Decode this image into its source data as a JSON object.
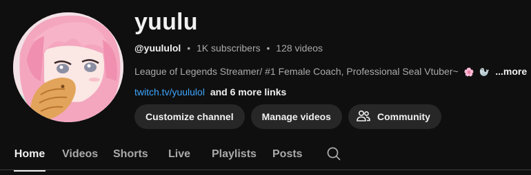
{
  "channel": {
    "name": "yuulu",
    "handle": "@yuululol",
    "subscribers": "1K subscribers",
    "videos": "128 videos",
    "separator": "•",
    "description": "League of Legends Streamer/ #1 Female Coach, Professional Seal Vtuber~",
    "description_emoji_1": "🌸",
    "description_emoji_2": "🦭",
    "more_label": "...more",
    "link": "twitch.tv/yuululol",
    "more_links": "and 6 more links"
  },
  "buttons": {
    "customize": "Customize channel",
    "manage": "Manage videos",
    "community": "Community",
    "community_icon": "people-icon"
  },
  "tabs": [
    {
      "label": "Home",
      "active": true
    },
    {
      "label": "Videos",
      "active": false
    },
    {
      "label": "Shorts",
      "active": false
    },
    {
      "label": "Live",
      "active": false
    },
    {
      "label": "Playlists",
      "active": false
    },
    {
      "label": "Posts",
      "active": false
    }
  ],
  "search_icon": "search-icon",
  "colors": {
    "background": "#0f0f0f",
    "text_primary": "#f1f1f1",
    "text_secondary": "#aaaaaa",
    "link": "#3ea6ff",
    "button_bg": "#272727"
  }
}
